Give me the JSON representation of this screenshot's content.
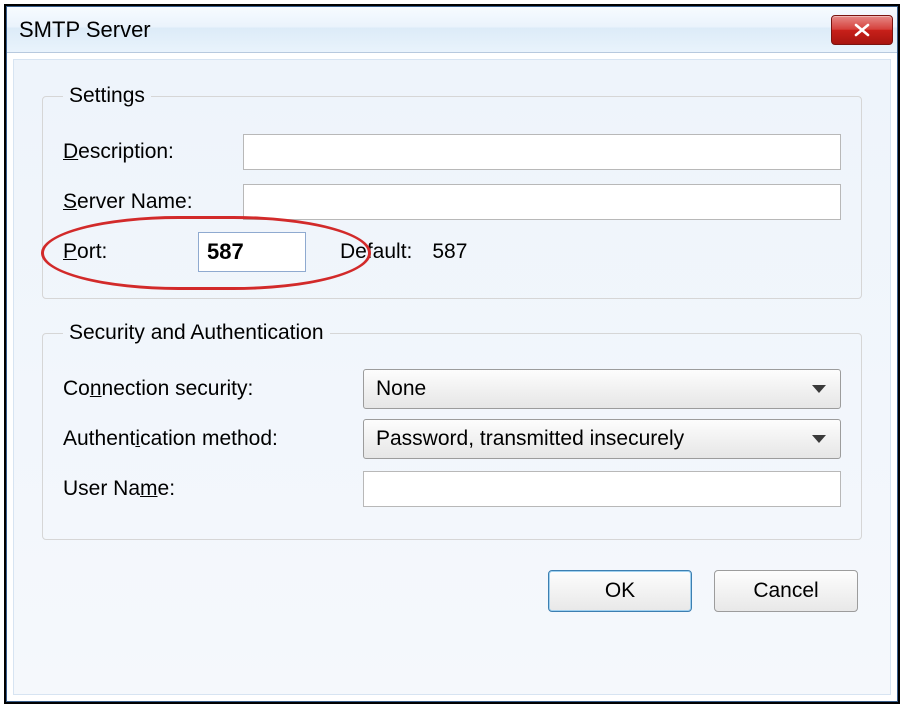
{
  "title": "SMTP Server",
  "settings": {
    "legend": "Settings",
    "description_label": "Description:",
    "description_value": "",
    "server_name_label": "Server Name:",
    "server_name_value": "",
    "port_label": "Port:",
    "port_value": "587",
    "port_default_label": "Default:",
    "port_default_value": "587"
  },
  "security": {
    "legend": "Security and Authentication",
    "conn_security_label": "Connection security:",
    "conn_security_value": "None",
    "auth_method_label": "Authentication method:",
    "auth_method_value": "Password, transmitted insecurely",
    "user_name_label": "User Name:",
    "user_name_value": ""
  },
  "buttons": {
    "ok": "OK",
    "cancel": "Cancel"
  }
}
